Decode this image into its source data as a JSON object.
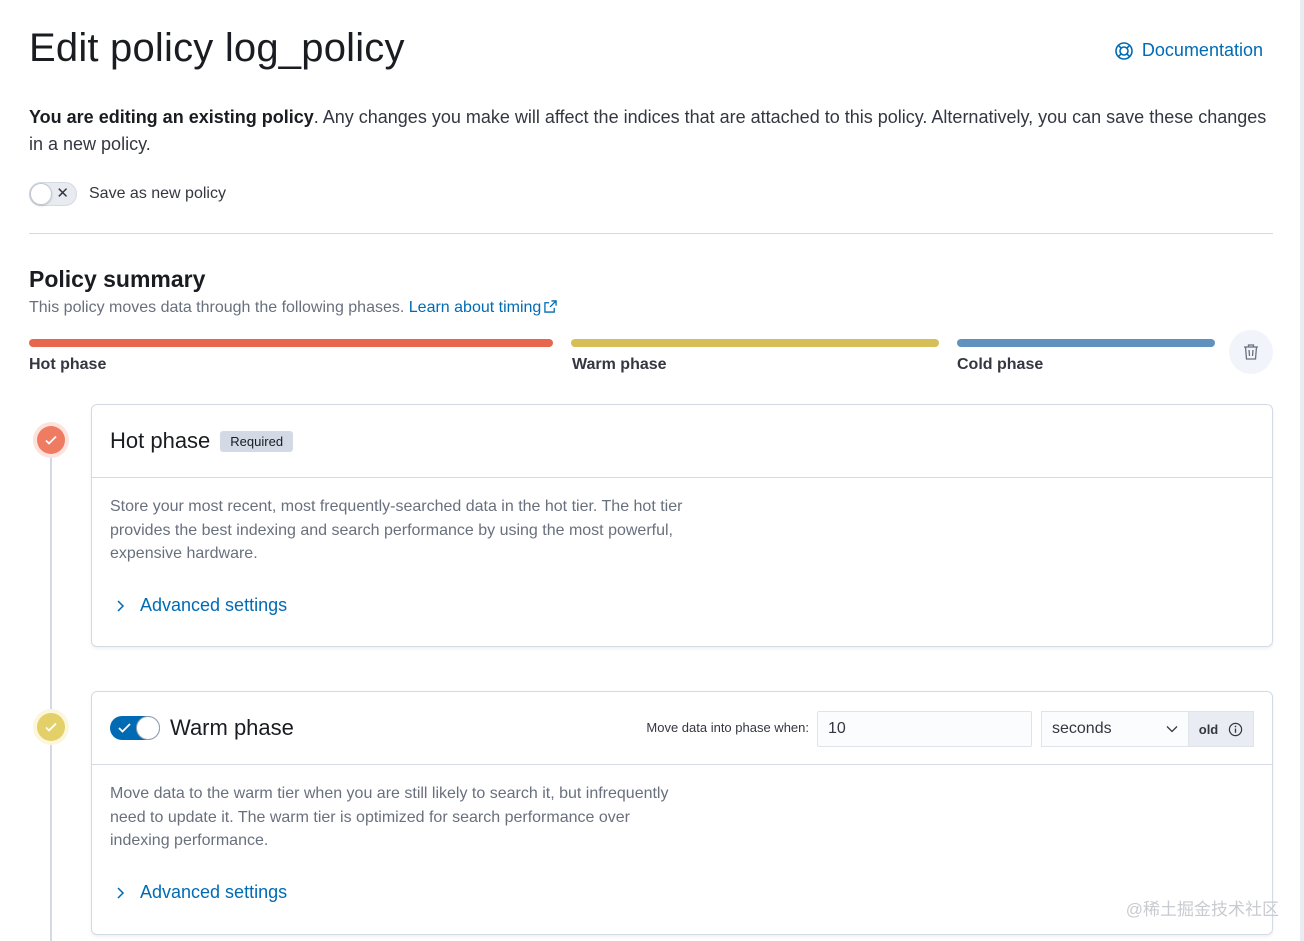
{
  "header": {
    "title": "Edit policy log_policy",
    "documentation_label": "Documentation"
  },
  "intro": {
    "bold": "You are editing an existing policy",
    "rest": ". Any changes you make will affect the indices that are attached to this policy. Alternatively, you can save these changes in a new policy."
  },
  "save_as_new": {
    "label": "Save as new policy",
    "enabled": false
  },
  "summary": {
    "title": "Policy summary",
    "description": "This policy moves data through the following phases.",
    "link_label": "Learn about timing",
    "phases": [
      {
        "label": "Hot phase",
        "color": "#e7664c"
      },
      {
        "label": "Warm phase",
        "color": "#d6bf57"
      },
      {
        "label": "Cold phase",
        "color": "#6092c0"
      }
    ]
  },
  "hot_phase": {
    "title": "Hot phase",
    "badge": "Required",
    "description": "Store your most recent, most frequently-searched data in the hot tier. The hot tier provides the best indexing and search performance by using the most powerful, expensive hardware.",
    "advanced_label": "Advanced settings"
  },
  "warm_phase": {
    "title": "Warm phase",
    "enabled": true,
    "move_label": "Move data into phase when:",
    "min_age_value": "10",
    "min_age_unit": "seconds",
    "append_label": "old",
    "description": "Move data to the warm tier when you are still likely to search it, but infrequently need to update it. The warm tier is optimized for search performance over indexing performance.",
    "advanced_label": "Advanced settings"
  },
  "watermark": "@稀土掘金技术社区",
  "colors": {
    "link": "#006bb4",
    "hot": "#e7664c",
    "warm": "#d6bf57",
    "cold": "#6092c0"
  }
}
